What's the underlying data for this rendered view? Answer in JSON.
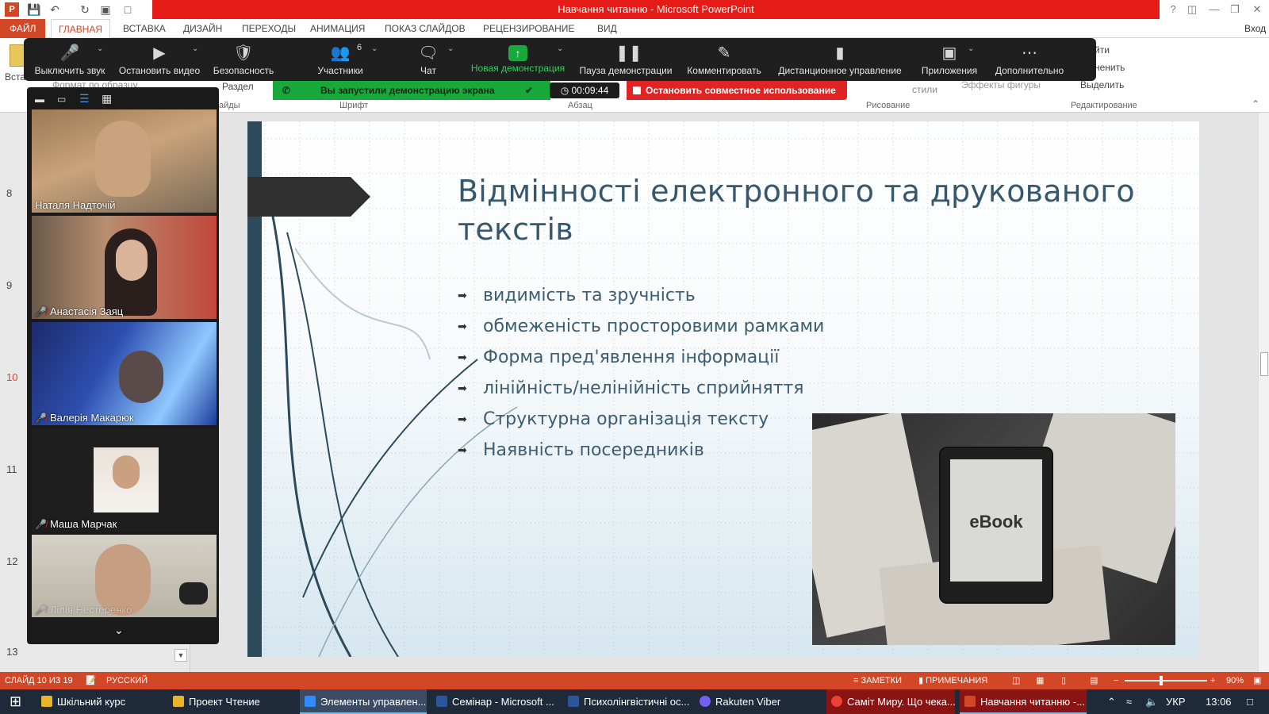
{
  "window": {
    "title": "Навчання читанню - Microsoft PowerPoint",
    "signin": "Вход",
    "help": "?"
  },
  "tabs": [
    "ФАЙЛ",
    "ГЛАВНАЯ",
    "ВСТАВКА",
    "ДИЗАЙН",
    "ПЕРЕХОДЫ",
    "АНИМАЦИЯ",
    "ПОКАЗ СЛАЙДОВ",
    "РЕЦЕНЗИРОВАНИЕ",
    "ВИД"
  ],
  "ribbon": {
    "paste": "Вста",
    "format_painter": "Формат по образцу",
    "section": "Раздел",
    "slides_group": "айды",
    "font_group": "Шрифт",
    "paragraph_group": "Абзац",
    "drawing_group": "Рисование",
    "editing_group": "Редактирование",
    "find": "йти",
    "replace": "ненить",
    "select": "Выделить",
    "styles": "стили",
    "shape_effects": "Эффекты фигуры"
  },
  "zoom_toolbar": {
    "mute": "Выключить звук",
    "stop_video": "Остановить видео",
    "security": "Безопасность",
    "participants": "Участники",
    "participants_count": "6",
    "chat": "Чат",
    "new_share": "Новая демонстрация",
    "pause_share": "Пауза демонстрации",
    "annotate": "Комментировать",
    "remote_control": "Дистанционное управление",
    "apps": "Приложения",
    "more": "Дополнительно"
  },
  "share_bar": {
    "status": "Вы запустили демонстрацию экрана",
    "timer": "00:09:44",
    "stop": "Остановить совместное использование"
  },
  "participants": [
    {
      "name": "Наталя Надточій",
      "muted": false
    },
    {
      "name": "Анастасія Заяц",
      "muted": true
    },
    {
      "name": "Валерія Макарюк",
      "muted": true
    },
    {
      "name": "Маша Марчак",
      "muted": true
    },
    {
      "name": "Лілія Нестеренко",
      "muted": true
    }
  ],
  "slide_numbers": [
    "8",
    "9",
    "10",
    "11",
    "12",
    "13"
  ],
  "slide": {
    "title": "Відмінності електронного та друкованого текстів",
    "bullets": [
      "видимість та зручність",
      "обмеженість просторовими рамками",
      "Форма пред'явлення інформації",
      "лінійність/нелінійність сприйняття",
      "Структурна організація тексту",
      "Наявність посередників"
    ],
    "image_label": "eBook"
  },
  "status": {
    "slide_info": "СЛАЙД 10 ИЗ 19",
    "language": "РУССКИЙ",
    "notes": "ЗАМЕТКИ",
    "comments": "ПРИМЕЧАНИЯ",
    "zoom": "90%"
  },
  "taskbar": {
    "items": [
      "Шкільний курс",
      "Проект Чтение",
      "Элементы управлен...",
      "Семінар - Microsoft ...",
      "Психолінгвістичні ос...",
      "Rakuten Viber",
      "Саміт Миру. Що чека...",
      "Навчання читанню -..."
    ],
    "lang": "УКР",
    "time": "13:06"
  },
  "colors": {
    "accent": "#d24726",
    "zoom_green": "#19a83c",
    "zoom_red": "#e02424",
    "title_text": "#35586e"
  }
}
